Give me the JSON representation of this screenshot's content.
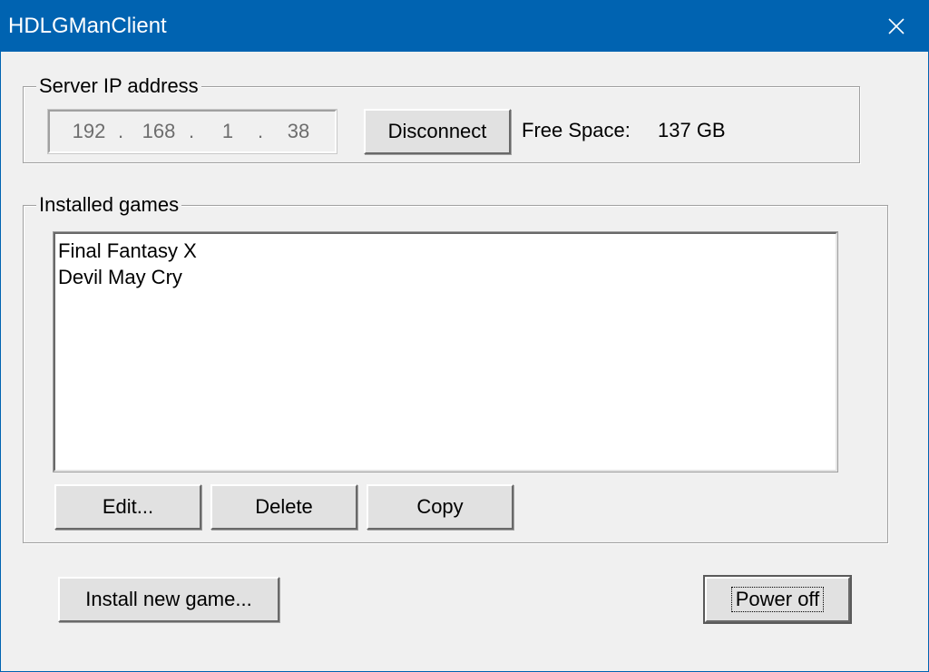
{
  "window": {
    "title": "HDLGManClient",
    "close_icon": "close-icon",
    "titlebar_color": "#0063b1"
  },
  "server_group": {
    "legend": "Server IP address",
    "ip": {
      "octet1": "192",
      "octet2": "168",
      "octet3": "1",
      "octet4": "38",
      "separator": "."
    },
    "disconnect_label": "Disconnect",
    "free_space_label": "Free Space:",
    "free_space_value": "137 GB"
  },
  "games_group": {
    "legend": "Installed games",
    "games": [
      "Final Fantasy X",
      "Devil May Cry"
    ],
    "edit_label": "Edit...",
    "delete_label": "Delete",
    "copy_label": "Copy"
  },
  "footer": {
    "install_label": "Install new game...",
    "power_off_label": "Power off"
  }
}
